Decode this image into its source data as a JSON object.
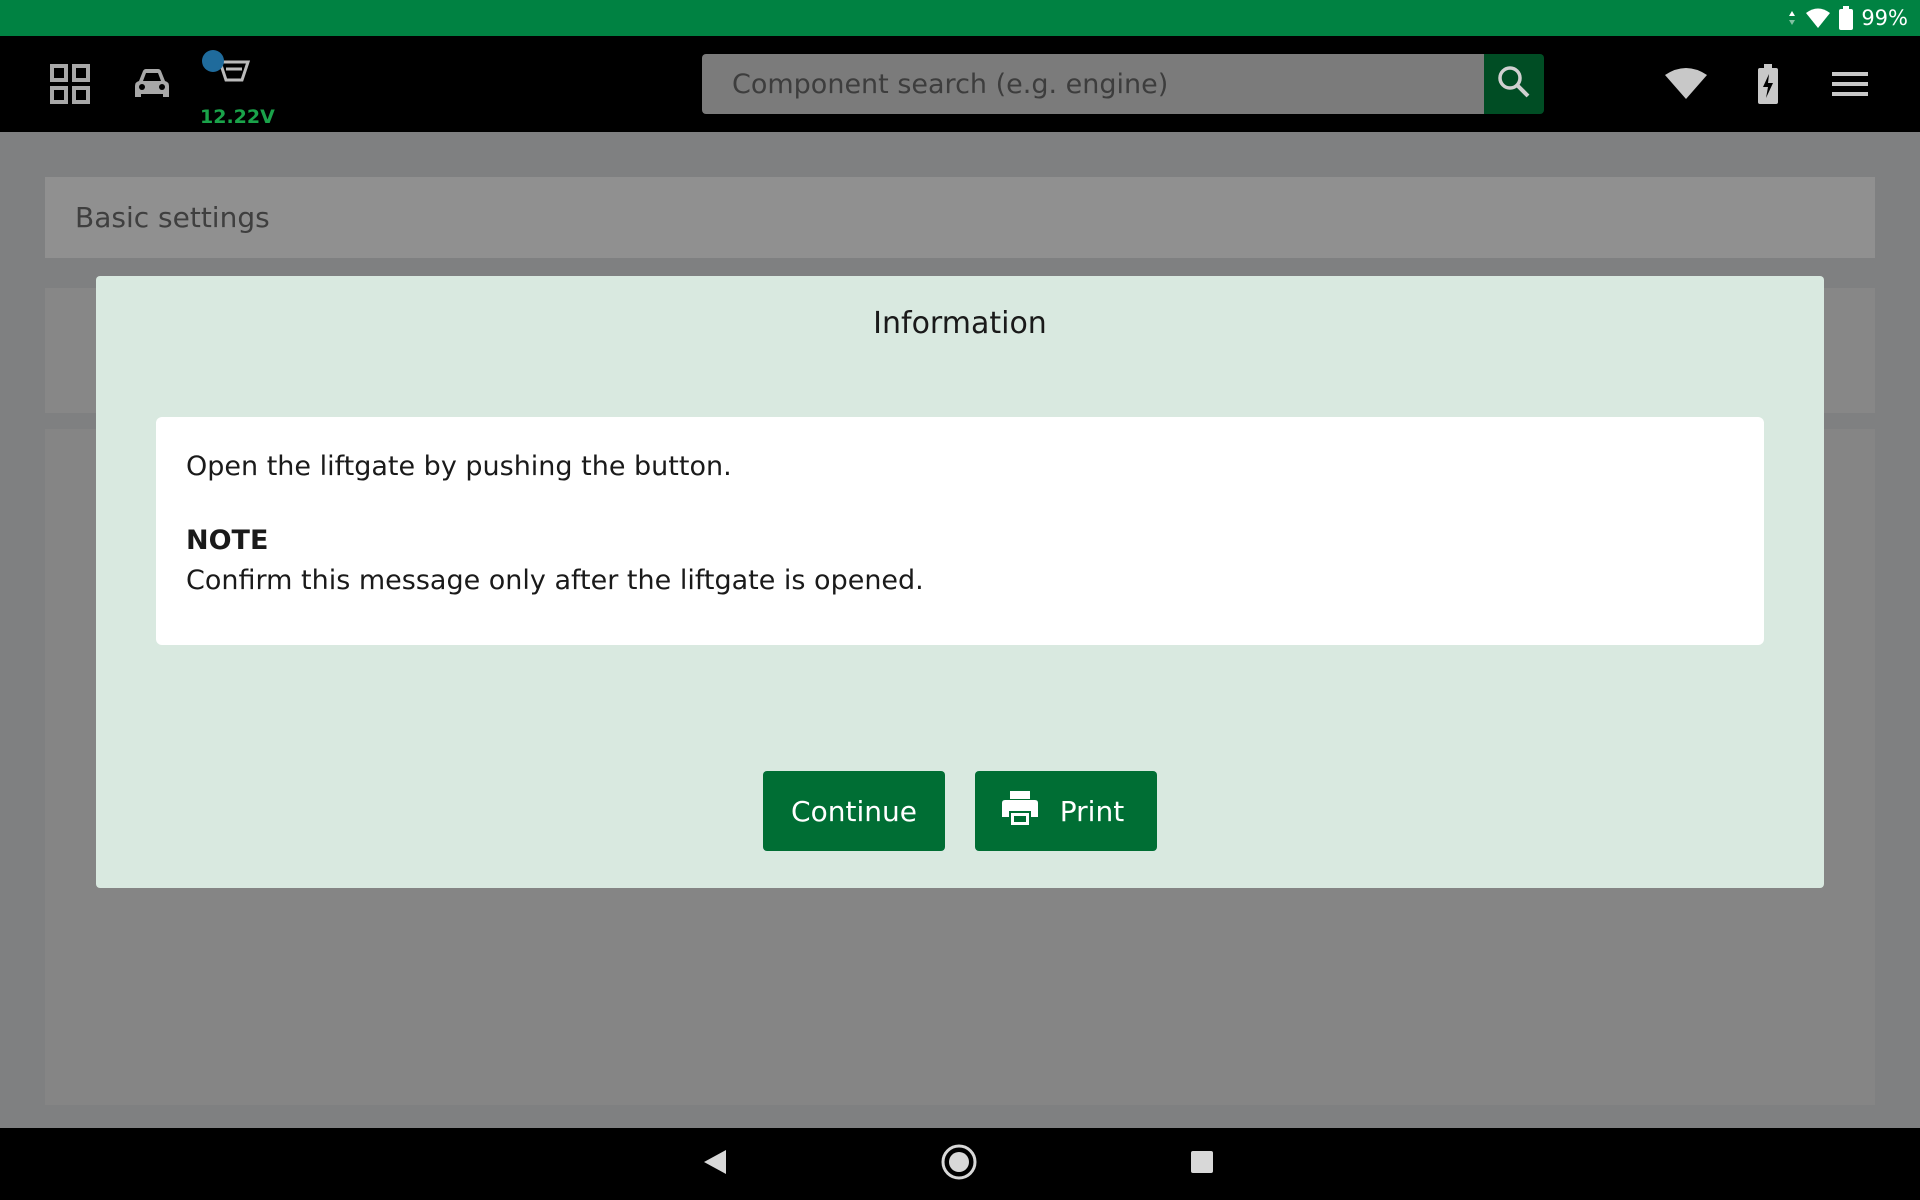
{
  "status_bar": {
    "battery_percent": "99%",
    "icons": [
      "data-arrows-icon",
      "wifi-signal-icon",
      "battery-icon"
    ]
  },
  "header": {
    "voltage": "12.22V",
    "search": {
      "placeholder": "Component search (e.g. engine)",
      "value": ""
    },
    "icons": [
      "grid-icon",
      "car-icon",
      "obd-connector-icon",
      "search-icon",
      "wifi-icon",
      "battery-charging-icon",
      "menu-icon"
    ]
  },
  "background": {
    "section_title": "Basic settings"
  },
  "dialog": {
    "title": "Information",
    "message_line1": "Open the liftgate by pushing the button.",
    "note_label": "NOTE",
    "message_line2": "Confirm this message only after the liftgate is opened.",
    "continue_label": "Continue",
    "print_label": "Print"
  },
  "colors": {
    "status_bar": "#008242",
    "button": "#006e34",
    "dialog_bg": "#d9e9e0",
    "voltage_text": "#1aa34a"
  },
  "nav_bar": {
    "icons": [
      "back-icon",
      "home-icon",
      "recents-icon"
    ]
  }
}
